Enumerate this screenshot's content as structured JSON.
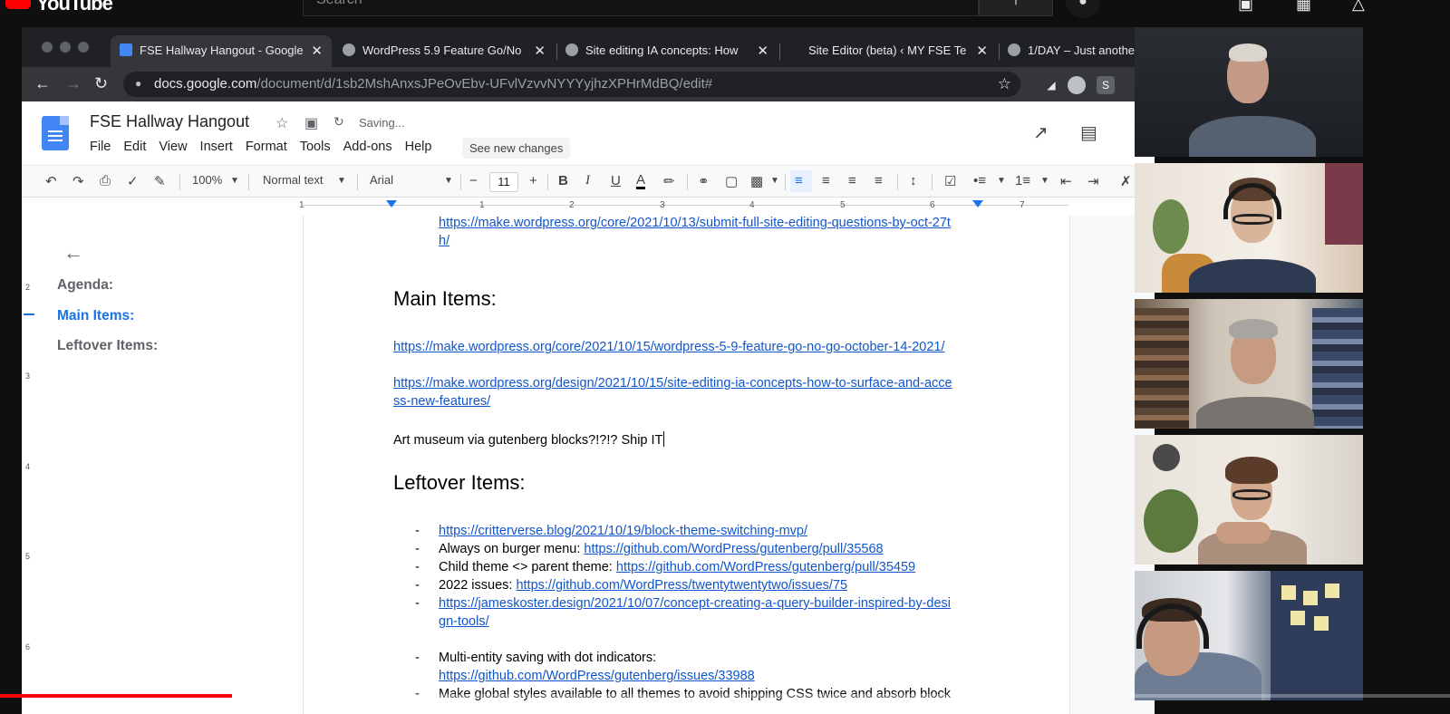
{
  "youtube": {
    "logo_text": "YouTube",
    "search_placeholder": "Search"
  },
  "browser": {
    "tabs": [
      {
        "label": "FSE Hallway Hangout - Google"
      },
      {
        "label": "WordPress 5.9 Feature Go/No"
      },
      {
        "label": "Site editing IA concepts: How"
      },
      {
        "label": "Site Editor (beta) ‹ MY FSE Te"
      },
      {
        "label": "1/DAY – Just anothe"
      }
    ],
    "url_host": "docs.google.com",
    "url_path": "/document/d/1sb2MshAnxsJPeOvEbv-UFvlVzvvNYYYyjhzXPHrMdBQ/edit#",
    "ext_s": "S"
  },
  "docs": {
    "title": "FSE Hallway Hangout",
    "status": "Saving...",
    "menu": [
      "File",
      "Edit",
      "View",
      "Insert",
      "Format",
      "Tools",
      "Add-ons",
      "Help"
    ],
    "see_changes": "See new changes",
    "toolbar": {
      "zoom": "100%",
      "style": "Normal text",
      "font": "Arial",
      "font_size": "11",
      "bold": "B",
      "italic": "I",
      "underline": "U",
      "text_color": "A"
    },
    "ruler_numbers": [
      "1",
      "1",
      "2",
      "3",
      "4",
      "5",
      "6",
      "7"
    ],
    "vruler_numbers": [
      "2",
      "3",
      "4",
      "5",
      "6"
    ],
    "outline": {
      "items": [
        {
          "label": "Agenda:"
        },
        {
          "label": "Main Items:"
        },
        {
          "label": "Leftover Items:"
        }
      ]
    },
    "body": {
      "top_link_1": "https://make.wordpress.org/core/2021/10/13/submit-full-site-editing-questions-by-oct-27t",
      "top_link_2": "h/",
      "main_heading": "Main Items:",
      "main_link_1": "https://make.wordpress.org/core/2021/10/15/wordpress-5-9-feature-go-no-go-october-14-2021/",
      "main_link_2a": "https://make.wordpress.org/design/2021/10/15/site-editing-ia-concepts-how-to-surface-and-acce",
      "main_link_2b": "ss-new-features/",
      "art_line": "Art museum via gutenberg blocks?!?!? Ship IT",
      "leftover_heading": "Leftover Items:",
      "bullet_dash": "-",
      "bullets": {
        "b1_link": "https://critterverse.blog/2021/10/19/block-theme-switching-mvp/",
        "b2_text": "Always on burger menu: ",
        "b2_link": "https://github.com/WordPress/gutenberg/pull/35568",
        "b3_text": "Child theme <> parent theme: ",
        "b3_link": "https://github.com/WordPress/gutenberg/pull/35459",
        "b4_text": "2022 issues: ",
        "b4_link": "https://github.com/WordPress/twentytwentytwo/issues/75",
        "b5_link_a": "https://jameskoster.design/2021/10/07/concept-creating-a-query-builder-inspired-by-desi",
        "b5_link_b": "gn-tools/",
        "b6_text": "Multi-entity saving with dot indicators:",
        "b6_link": "https://github.com/WordPress/gutenberg/issues/33988",
        "b7_text": "Make global styles available to all themes to avoid shipping CSS twice and absorb block"
      }
    }
  },
  "video": {
    "progress_played": 0.16,
    "progress_loaded": 0.195
  },
  "colors": {
    "link": "#1155cc",
    "accent": "#1a73e8",
    "youtube_red": "#ff0000"
  }
}
